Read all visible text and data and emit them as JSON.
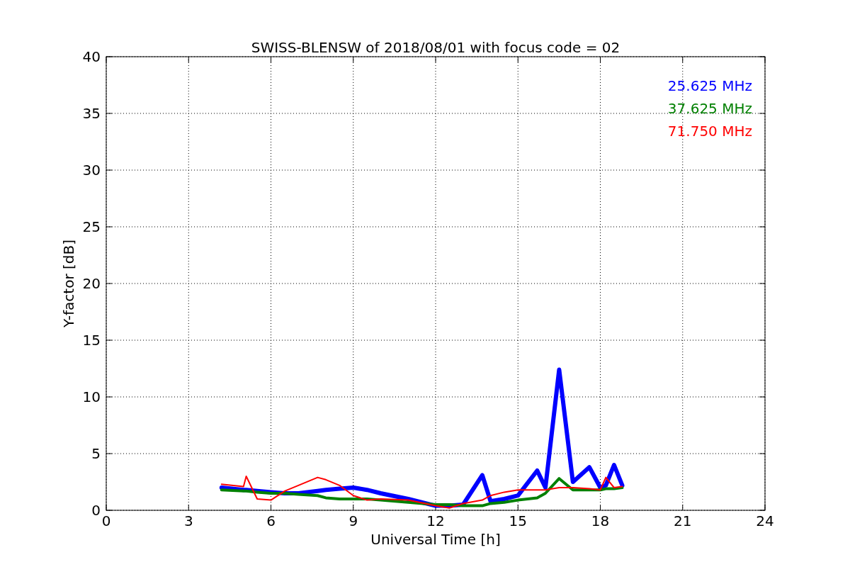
{
  "chart": {
    "chart_data": {
      "type": "line",
      "title": "SWISS-BLENSW of 2018/08/01 with focus code = 02",
      "xlabel": "Universal Time [h]",
      "ylabel": "Y-factor [dB]",
      "x": [
        4.2,
        5,
        5.1,
        5.5,
        6,
        6.5,
        7,
        7.7,
        8,
        8.5,
        9,
        9.5,
        10,
        11,
        12,
        12.5,
        13,
        13.7,
        14,
        14.5,
        15,
        15.7,
        16,
        16.5,
        17,
        17.6,
        18,
        18.2,
        18.5,
        18.8
      ],
      "series": [
        {
          "name": "25.625 MHz",
          "color": "#0000ff",
          "values": [
            2.0,
            1.8,
            1.8,
            1.7,
            1.6,
            1.5,
            1.5,
            1.7,
            1.8,
            1.9,
            2.0,
            1.8,
            1.5,
            1.0,
            0.4,
            0.4,
            0.5,
            3.1,
            0.8,
            1.0,
            1.3,
            3.5,
            2.0,
            12.4,
            2.5,
            3.8,
            2.0,
            2.2,
            4.0,
            2.2
          ]
        },
        {
          "name": "37.625 MHz",
          "color": "#008000",
          "values": [
            1.8,
            1.7,
            1.7,
            1.6,
            1.5,
            1.5,
            1.4,
            1.3,
            1.1,
            1.0,
            1.0,
            1.0,
            0.9,
            0.7,
            0.5,
            0.5,
            0.4,
            0.4,
            0.6,
            0.7,
            0.9,
            1.1,
            1.5,
            2.8,
            1.8,
            1.8,
            1.8,
            1.9,
            1.9,
            2.0
          ]
        },
        {
          "name": "71.750 MHz",
          "color": "#ff0000",
          "values": [
            2.3,
            2.1,
            3.0,
            1.0,
            0.9,
            1.7,
            2.2,
            2.9,
            2.7,
            2.2,
            1.3,
            0.9,
            1.0,
            0.9,
            0.4,
            0.2,
            0.6,
            0.9,
            1.3,
            1.6,
            1.8,
            1.8,
            1.8,
            2.0,
            2.0,
            1.9,
            1.8,
            2.9,
            2.0,
            2.1
          ]
        }
      ],
      "xlim": [
        0,
        24
      ],
      "ylim": [
        0,
        40
      ],
      "xticks": [
        0,
        3,
        6,
        9,
        12,
        15,
        18,
        21,
        24
      ],
      "yticks": [
        0,
        5,
        10,
        15,
        20,
        25,
        30,
        35,
        40
      ],
      "grid": true
    }
  }
}
